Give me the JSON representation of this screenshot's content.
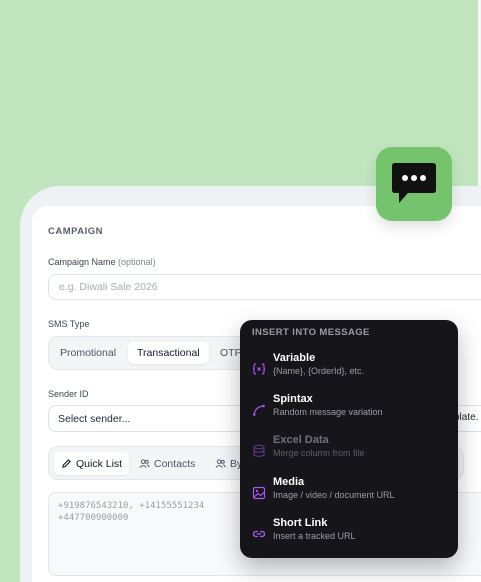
{
  "campaign": {
    "section_title": "CAMPAIGN",
    "name_label": "Campaign Name",
    "name_optional": "(optional)",
    "name_placeholder": "e.g. Diwali Sale 2026",
    "sms_type_label": "SMS Type",
    "sms_types": [
      "Promotional",
      "Transactional",
      "OTP"
    ],
    "sms_type_selected": "Transactional",
    "sender_label": "Sender ID",
    "sender_placeholder": "Select sender...",
    "template_partial": "plate.",
    "recipient_tabs": [
      "Quick List",
      "Contacts",
      "By"
    ],
    "recipient_tab_selected": "Quick List",
    "numbers_placeholder": "+919876543210, +14155551234\n+447700900000"
  },
  "insert_menu": {
    "title": "INSERT INTO MESSAGE",
    "items": [
      {
        "label": "Variable",
        "desc": "{Name}, {OrderId}, etc.",
        "icon": "variable-icon",
        "enabled": true
      },
      {
        "label": "Spintax",
        "desc": "Random message variation",
        "icon": "spintax-icon",
        "enabled": true
      },
      {
        "label": "Excel Data",
        "desc": "Merge column from file",
        "icon": "database-icon",
        "enabled": false
      },
      {
        "label": "Media",
        "desc": "Image / video / document URL",
        "icon": "image-icon",
        "enabled": true
      },
      {
        "label": "Short Link",
        "desc": "Insert a tracked URL",
        "icon": "link-icon",
        "enabled": true
      }
    ]
  },
  "colors": {
    "background": "#c1e6bf",
    "app_icon": "#75c46d",
    "menu_bg": "#16161a",
    "menu_icon_accent": "#a855f7"
  }
}
